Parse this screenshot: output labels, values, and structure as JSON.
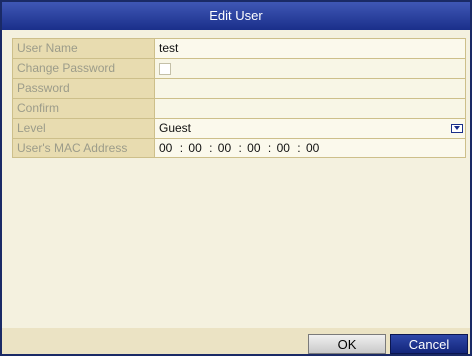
{
  "dialog": {
    "title": "Edit User"
  },
  "form": {
    "user_name": {
      "label": "User Name",
      "value": "test"
    },
    "change_password": {
      "label": "Change Password",
      "checked": false
    },
    "password": {
      "label": "Password",
      "value": ""
    },
    "confirm": {
      "label": "Confirm",
      "value": ""
    },
    "level": {
      "label": "Level",
      "value": "Guest"
    },
    "mac": {
      "label": "User's MAC Address",
      "segments": [
        "00",
        "00",
        "00",
        "00",
        "00",
        "00"
      ],
      "separator": ":"
    }
  },
  "buttons": {
    "ok": "OK",
    "cancel": "Cancel"
  },
  "colors": {
    "title_bar": "#1a2f8a",
    "label_bg": "#e8dcb0",
    "value_bg": "#f8f6e6"
  },
  "icons": {
    "checkbox": "checkbox-icon",
    "dropdown": "chevron-down-icon"
  }
}
